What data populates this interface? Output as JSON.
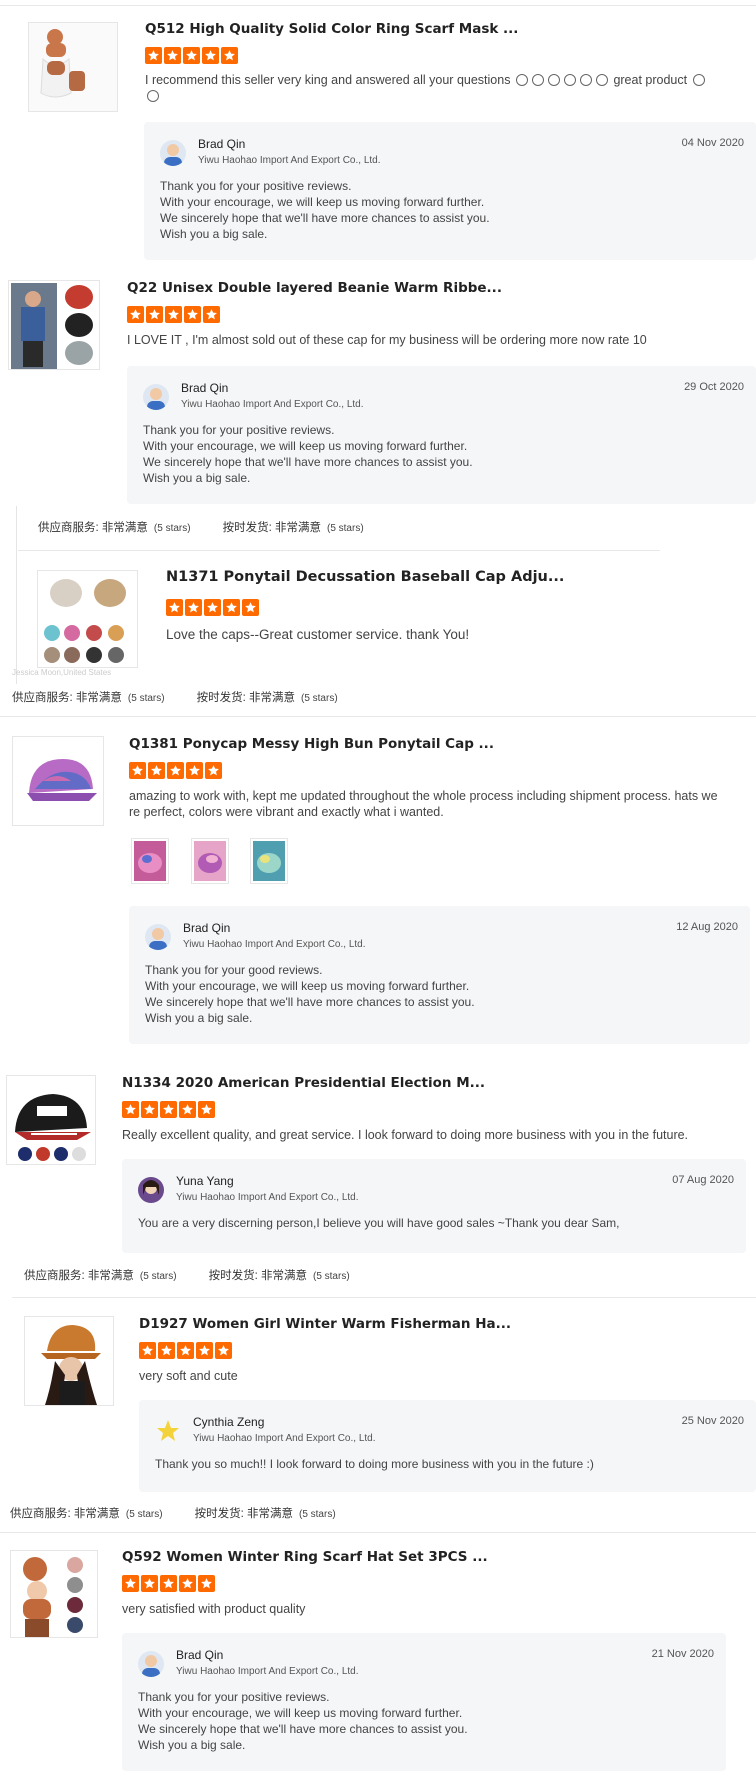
{
  "colors": {
    "star": "#ff6a00",
    "reply_bg": "#f5f6f8"
  },
  "icons": {
    "star": "star-icon",
    "avatar": "user-avatar-icon",
    "emoji": "emoji-icon"
  },
  "reviews": [
    {
      "title": "Q512 High Quality Solid Color Ring Scarf Mask ...",
      "rating": 5,
      "text_a": "I recommend this seller very king and answered all your questions",
      "text_b": "great product",
      "reply": {
        "name": "Brad Qin",
        "company": "Yiwu Haohao Import And Export Co., Ltd.",
        "date": "04 Nov 2020",
        "lines": [
          "Thank you for your positive reviews.",
          "With your encourage, we will keep us moving forward further.",
          "We sincerely hope that we'll have more chances to assist you.",
          "Wish you a big sale."
        ]
      }
    },
    {
      "title": "Q22 Unisex Double layered Beanie Warm Ribbe...",
      "rating": 5,
      "text": "I LOVE IT , I'm almost sold out of these cap for my business will be ordering more now rate 10",
      "reply": {
        "name": "Brad Qin",
        "company": "Yiwu Haohao Import And Export Co., Ltd.",
        "date": "29 Oct 2020",
        "lines": [
          "Thank you for your positive reviews.",
          "With your encourage, we will keep us moving forward further.",
          "We sincerely hope that we'll have more chances to assist you.",
          "Wish you a big sale."
        ]
      }
    },
    {
      "title": "N1371 Ponytail Decussation Baseball Cap Adju...",
      "rating": 5,
      "text": "Love the caps--Great customer service. thank You!"
    },
    {
      "title": "Q1381 Ponycap Messy High Bun Ponytail Cap ...",
      "rating": 5,
      "text_lines": [
        "amazing to work with, kept me updated throughout the whole process including shipment process. hats we",
        "re perfect, colors were vibrant and exactly what i wanted."
      ],
      "reply": {
        "name": "Brad Qin",
        "company": "Yiwu Haohao Import And Export Co., Ltd.",
        "date": "12 Aug 2020",
        "lines": [
          "Thank you for your good reviews.",
          "With your encourage, we will keep us moving forward further.",
          "We sincerely hope that we'll have more chances to assist you.",
          "Wish you a big sale."
        ]
      }
    },
    {
      "title": "N1334 2020 American Presidential Election M...",
      "rating": 5,
      "text": "Really excellent quality, and great service. I look forward to doing more business with you in the future.",
      "reply": {
        "name": "Yuna Yang",
        "company": "Yiwu Haohao Import And Export Co., Ltd.",
        "date": "07 Aug 2020",
        "lines": [
          "You are a very discerning person,I believe you will have good sales ~Thank you dear Sam,"
        ]
      }
    },
    {
      "title": "D1927 Women Girl Winter Warm Fisherman Ha...",
      "rating": 5,
      "text": "very soft and cute",
      "reply": {
        "name": "Cynthia Zeng",
        "company": "Yiwu Haohao Import And Export Co., Ltd.",
        "date": "25 Nov 2020",
        "lines": [
          "Thank you so much!! I look forward to doing more business with you in the future :)"
        ]
      }
    },
    {
      "title": "Q592 Women Winter Ring Scarf Hat Set 3PCS ...",
      "rating": 5,
      "text": "very satisfied with product quality",
      "reply": {
        "name": "Brad Qin",
        "company": "Yiwu Haohao Import And Export Co., Ltd.",
        "date": "21 Nov 2020",
        "lines": [
          "Thank you for your positive reviews.",
          "With your encourage, we will keep us moving forward further.",
          "We sincerely hope that we'll have more chances to assist you.",
          "Wish you a big sale."
        ]
      }
    }
  ],
  "meta": {
    "service_label": "供应商服务:",
    "service_value": "非常满意",
    "ship_label": "按时发货:",
    "ship_value": "非常满意",
    "stars_text": "(5 stars)"
  },
  "ghost_text": "Jessica Moon,United States"
}
